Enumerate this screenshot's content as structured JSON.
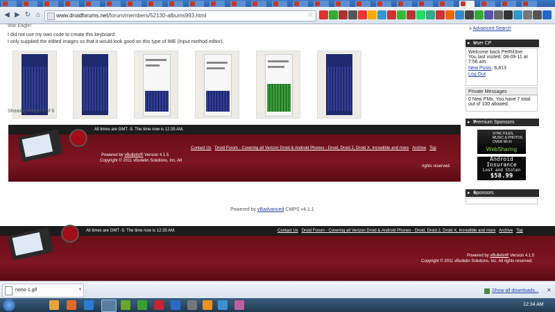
{
  "browser": {
    "tab_count": 26,
    "active_tab_title": "Ne",
    "url_domain": "www.droidforums.net",
    "url_path": "/forum/members/52130-albums993.html"
  },
  "content": {
    "intro_partial": "War Eagle!",
    "paragraph1": "I did not use my own code to create this keyboard.",
    "paragraph2": "I only supplied the edited images so that it would look good on this type of IME (Input method editor).",
    "showing_text": "Showing image 6 of 6",
    "thumb_count": 6
  },
  "footer_inner": {
    "time_note": "All times are GMT -5. The time now is 12:35 AM.",
    "links": [
      "Contact Us",
      "Droid Forum - Covering all Verizon Droid & Android Phones - Droid, Droid 2, Droid X, Incredible and more",
      "Archive",
      "Top"
    ],
    "powered_prefix": "Powered by ",
    "powered_link": "vBulletin®",
    "powered_suffix": " Version 4.1.5",
    "copyright": "Copyright © 2011 vBulletin Solutions, Inc. All",
    "rights": "rights reserved."
  },
  "vbadvanced": {
    "prefix": "Powered by ",
    "link": "vBadvanced",
    "suffix": " CMPS v4.1.1"
  },
  "footer_outer": {
    "time_note": "All times are GMT -5. The time now is 12:35 AM.",
    "links": [
      "Contact Us",
      "Droid Forum - Covering all Verizon Droid & Android Phones - Droid, Droid 2, Droid X, Incredible and more",
      "Archive",
      "Top"
    ],
    "powered_prefix": "Powered by ",
    "powered_link": "vBulletin®",
    "powered_suffix": " Version 4.1.5",
    "copyright": "Copyright © 2011 vBulletin Solutions, Inc. All rights reserved."
  },
  "sidebar": {
    "advanced_search": "Advanced Search",
    "user_cp_title": "User CP",
    "welcome": "Welcome back PetRil3oe",
    "last_visited": "You last visited: 08-09-11 at 7:56 am",
    "new_posts_label": "New Posts",
    "new_posts_count": ": 6,813",
    "logout": "Log Out",
    "pm_title": "Private Messages",
    "pm_text": "0 New PMs. You have 7 total out of 100 allowed.",
    "premium_title": "Premium Sponsors",
    "ad1_line1": "SYNC FILES, MUSIC & PHOTOS OVER WI-FI",
    "ad1_line2": "WebSharing",
    "ad2_line1": "Android",
    "ad2_line2": "Insurance",
    "ad2_line3": "Lost and Stolen",
    "ad2_price": "$58.99",
    "sponsors_title": "Sponsors"
  },
  "downloads": {
    "file_name": "nono-1.gif",
    "show_all": "Show all downloads..."
  },
  "taskbar": {
    "time": "12:34 AM"
  },
  "colors": {
    "footer_red": "#7d1422",
    "footer_dark": "#1c1c1c",
    "link_blue": "#2244aa"
  }
}
